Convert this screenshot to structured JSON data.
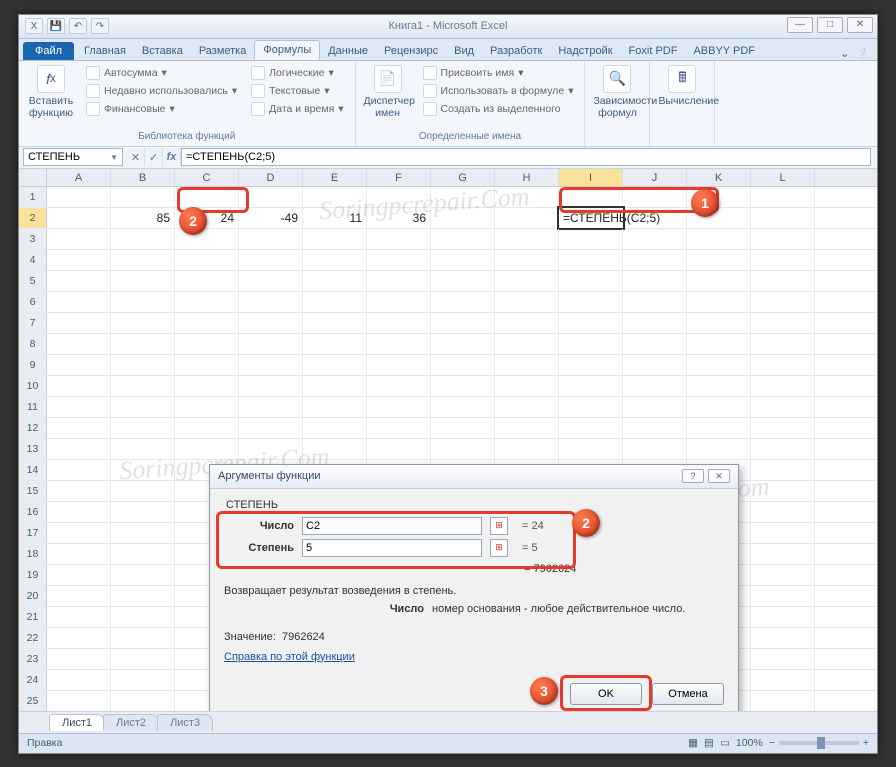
{
  "title": "Книга1 - Microsoft Excel",
  "tabs": {
    "file": "Файл",
    "home": "Главная",
    "insert": "Вставка",
    "layout": "Разметка",
    "formulas": "Формулы",
    "data": "Данные",
    "review": "Рецензирс",
    "view": "Вид",
    "developer": "Разработк",
    "addins": "Надстройк",
    "foxit": "Foxit PDF",
    "abbyy": "ABBYY PDF"
  },
  "ribbon": {
    "insert_fn_label": "Вставить функцию",
    "autosum": "Автосумма",
    "recent": "Недавно использовались",
    "financial": "Финансовые",
    "logical": "Логические",
    "text": "Текстовые",
    "datetime": "Дата и время",
    "lib_label": "Библиотека функций",
    "name_mgr": "Диспетчер имен",
    "assign": "Присвоить имя",
    "use_in": "Использовать в формуле",
    "create_sel": "Создать из выделенного",
    "defined_label": "Определенные имена",
    "deps": "Зависимости формул",
    "calc": "Вычисление"
  },
  "namebox": "СТЕПЕНЬ",
  "formula": "=СТЕПЕНЬ(C2;5)",
  "columns": [
    "A",
    "B",
    "C",
    "D",
    "E",
    "F",
    "G",
    "H",
    "I",
    "J",
    "K",
    "L"
  ],
  "active_col": "I",
  "row2": {
    "B": "85",
    "C": "24",
    "D": "-49",
    "E": "11",
    "F": "36",
    "I": "=СТЕПЕНЬ(C2;5)"
  },
  "dialog": {
    "title": "Аргументы функции",
    "fn": "СТЕПЕНЬ",
    "arg1_label": "Число",
    "arg1_val": "C2",
    "arg1_res": "24",
    "arg2_label": "Степень",
    "arg2_val": "5",
    "arg2_res": "5",
    "result": "7962624",
    "desc": "Возвращает результат возведения в степень.",
    "argdesc_name": "Число",
    "argdesc_text": "номер основания - любое действительное число.",
    "value_label": "Значение:",
    "value": "7962624",
    "help": "Справка по этой функции",
    "ok": "OK",
    "cancel": "Отмена"
  },
  "sheets": {
    "s1": "Лист1",
    "s2": "Лист2",
    "s3": "Лист3"
  },
  "status": {
    "mode": "Правка",
    "zoom": "100%"
  },
  "watermark": "Soringpcrepair.Com"
}
